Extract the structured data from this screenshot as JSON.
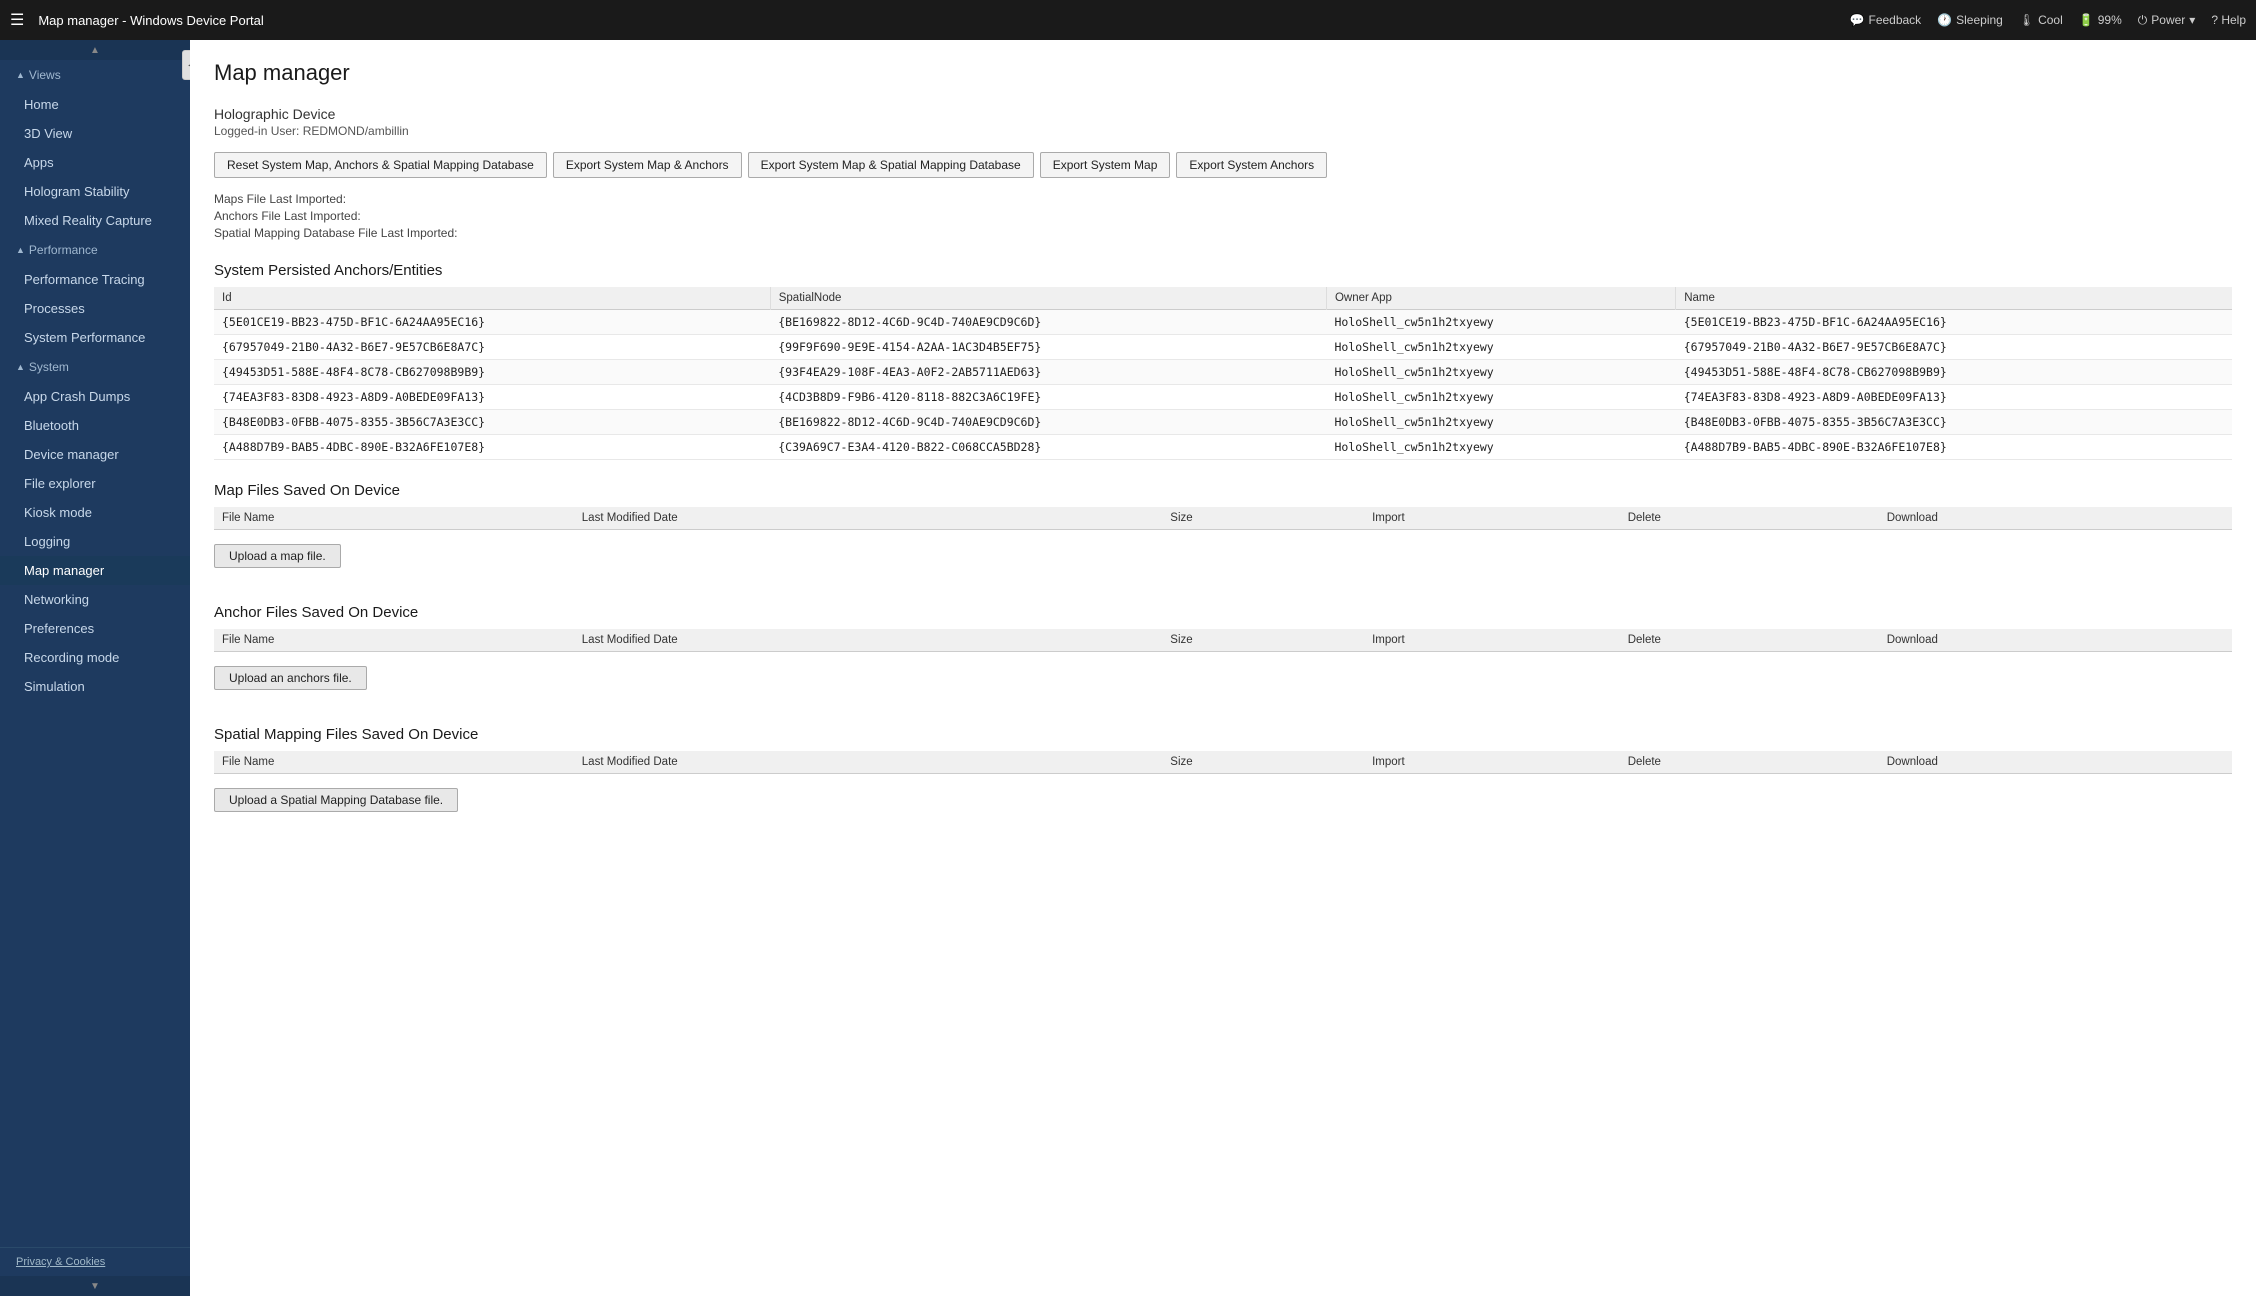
{
  "titlebar": {
    "title": "Map manager - Windows Device Portal",
    "controls": {
      "feedback": "Feedback",
      "sleeping": "Sleeping",
      "cool": "Cool",
      "battery": "99%",
      "power": "Power",
      "help": "? Help"
    }
  },
  "sidebar": {
    "collapse_arrow": "◀",
    "sections": [
      {
        "name": "Views",
        "items": [
          "Home",
          "3D View",
          "Apps",
          "Hologram Stability",
          "Mixed Reality Capture"
        ]
      },
      {
        "name": "Performance",
        "items": [
          "Performance Tracing",
          "Processes",
          "System Performance"
        ]
      },
      {
        "name": "System",
        "items": [
          "App Crash Dumps",
          "Bluetooth",
          "Device manager",
          "File explorer",
          "Kiosk mode",
          "Logging",
          "Map manager",
          "Networking",
          "Preferences",
          "Recording mode",
          "Simulation"
        ]
      }
    ],
    "active_item": "Map manager",
    "bottom_link": "Privacy & Cookies"
  },
  "page": {
    "title": "Map manager",
    "device_section": "Holographic Device",
    "logged_in_user": "Logged-in User: REDMOND/ambillin",
    "buttons": {
      "reset": "Reset System Map, Anchors & Spatial Mapping Database",
      "export_map_anchors": "Export System Map & Anchors",
      "export_map_spatial": "Export System Map & Spatial Mapping Database",
      "export_map": "Export System Map",
      "export_anchors": "Export System Anchors"
    },
    "import_info": {
      "maps_file": "Maps File Last Imported:",
      "anchors_file": "Anchors File Last Imported:",
      "spatial_file": "Spatial Mapping Database File Last Imported:"
    },
    "anchors_section": {
      "heading": "System Persisted Anchors/Entities",
      "columns": [
        "Id",
        "SpatialNode",
        "Owner App",
        "Name"
      ],
      "rows": [
        {
          "id": "{5E01CE19-BB23-475D-BF1C-6A24AA95EC16}",
          "spatial_node": "{BE169822-8D12-4C6D-9C4D-740AE9CD9C6D}",
          "owner_app": "HoloShell_cw5n1h2txyewy",
          "name": "{5E01CE19-BB23-475D-BF1C-6A24AA95EC16}"
        },
        {
          "id": "{67957049-21B0-4A32-B6E7-9E57CB6E8A7C}",
          "spatial_node": "{99F9F690-9E9E-4154-A2AA-1AC3D4B5EF75}",
          "owner_app": "HoloShell_cw5n1h2txyewy",
          "name": "{67957049-21B0-4A32-B6E7-9E57CB6E8A7C}"
        },
        {
          "id": "{49453D51-588E-48F4-8C78-CB627098B9B9}",
          "spatial_node": "{93F4EA29-108F-4EA3-A0F2-2AB5711AED63}",
          "owner_app": "HoloShell_cw5n1h2txyewy",
          "name": "{49453D51-588E-48F4-8C78-CB627098B9B9}"
        },
        {
          "id": "{74EA3F83-83D8-4923-A8D9-A0BEDE09FA13}",
          "spatial_node": "{4CD3B8D9-F9B6-4120-8118-882C3A6C19FE}",
          "owner_app": "HoloShell_cw5n1h2txyewy",
          "name": "{74EA3F83-83D8-4923-A8D9-A0BEDE09FA13}"
        },
        {
          "id": "{B48E0DB3-0FBB-4075-8355-3B56C7A3E3CC}",
          "spatial_node": "{BE169822-8D12-4C6D-9C4D-740AE9CD9C6D}",
          "owner_app": "HoloShell_cw5n1h2txyewy",
          "name": "{B48E0DB3-0FBB-4075-8355-3B56C7A3E3CC}"
        },
        {
          "id": "{A488D7B9-BAB5-4DBC-890E-B32A6FE107E8}",
          "spatial_node": "{C39A69C7-E3A4-4120-B822-C068CCA5BD28}",
          "owner_app": "HoloShell_cw5n1h2txyewy",
          "name": "{A488D7B9-BAB5-4DBC-890E-B32A6FE107E8}"
        }
      ]
    },
    "map_files_section": {
      "heading": "Map Files Saved On Device",
      "columns": [
        "File Name",
        "Last Modified Date",
        "Size",
        "Import",
        "Delete",
        "Download"
      ],
      "upload_btn": "Upload a map file."
    },
    "anchor_files_section": {
      "heading": "Anchor Files Saved On Device",
      "columns": [
        "File Name",
        "Last Modified Date",
        "Size",
        "Import",
        "Delete",
        "Download"
      ],
      "upload_btn": "Upload an anchors file."
    },
    "spatial_files_section": {
      "heading": "Spatial Mapping Files Saved On Device",
      "columns": [
        "File Name",
        "Last Modified Date",
        "Size",
        "Import",
        "Delete",
        "Download"
      ],
      "upload_btn": "Upload a Spatial Mapping Database file."
    }
  }
}
